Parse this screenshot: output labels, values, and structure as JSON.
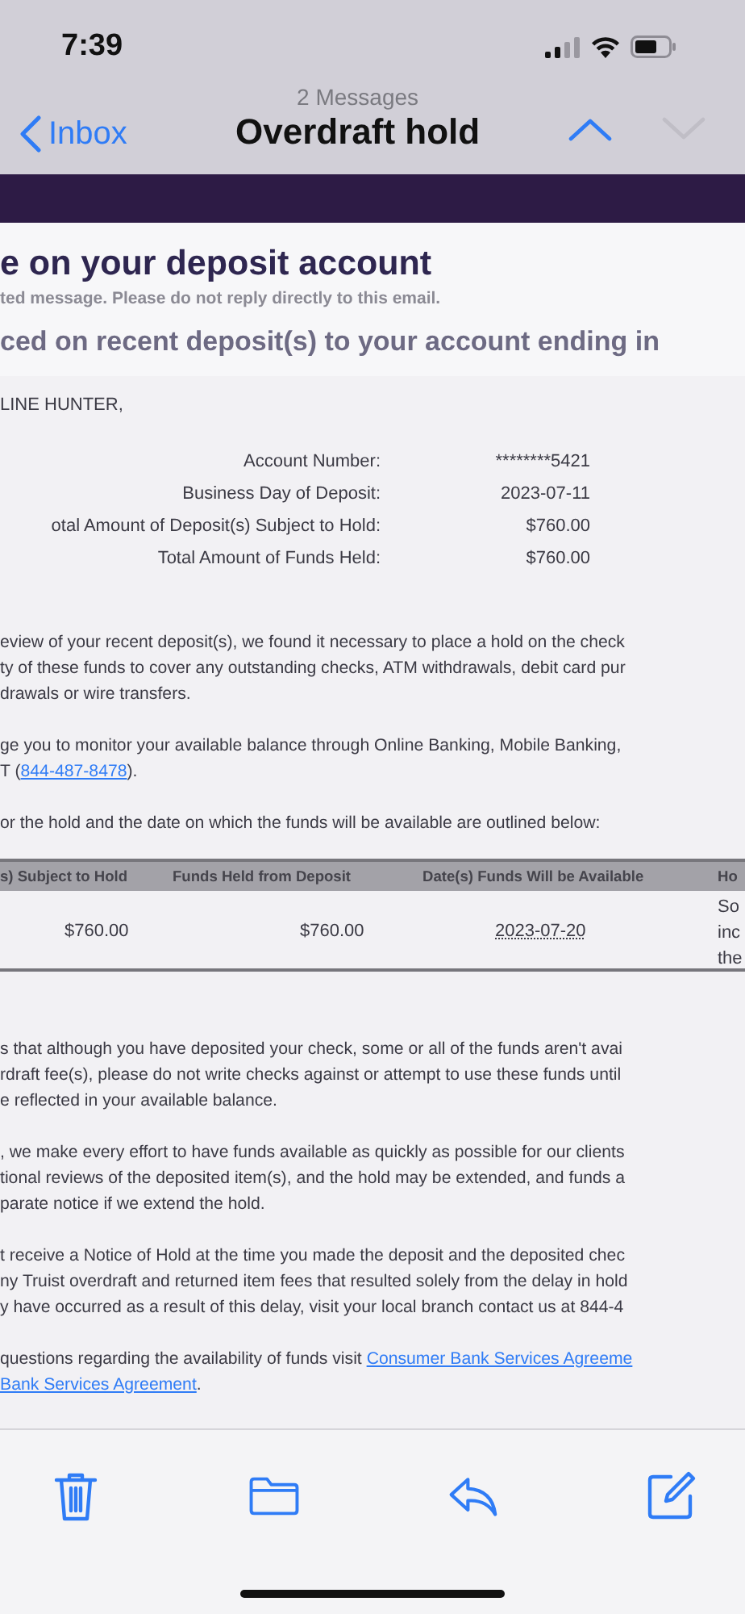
{
  "status_bar": {
    "time": "7:39"
  },
  "nav": {
    "back": "Inbox",
    "count": "2 Messages",
    "title": "Overdraft hold",
    "previous": {
      "disabled": false
    },
    "next": {
      "disabled": true
    }
  },
  "email": {
    "heading": "e on your deposit account",
    "notice": "ted message. Please do not reply directly to this email.",
    "subheading": "ced on recent deposit(s) to your account ending in",
    "greeting": "LINE HUNTER,",
    "details": [
      {
        "label": "Account Number:",
        "value": "********5421"
      },
      {
        "label": "Business Day of Deposit:",
        "value": "2023-07-11"
      },
      {
        "label": "otal Amount of Deposit(s) Subject to Hold:",
        "value": "$760.00"
      },
      {
        "label": "Total Amount of Funds Held:",
        "value": "$760.00"
      }
    ],
    "paragraphs": [
      {
        "lines": [
          [
            {
              "kind": "text",
              "text": "eview of your recent deposit(s), we found it necessary to place a hold on the check"
            }
          ],
          [
            {
              "kind": "text",
              "text": "ty of these funds to cover any outstanding checks, ATM withdrawals, debit card pur"
            }
          ],
          [
            {
              "kind": "text",
              "text": "drawals or wire transfers."
            }
          ]
        ]
      },
      {
        "lines": [
          [
            {
              "kind": "text",
              "text": "ge you to monitor your available balance through Online Banking, Mobile Banking,"
            }
          ],
          [
            {
              "kind": "text",
              "text": "T ("
            },
            {
              "kind": "link",
              "text": "844-487-8478"
            },
            {
              "kind": "text",
              "text": ")."
            }
          ]
        ]
      },
      {
        "lines": [
          [
            {
              "kind": "text",
              "text": "or the hold and the date on which the funds will be available are outlined below:"
            }
          ]
        ]
      }
    ],
    "table": {
      "columns": [
        "s) Subject to Hold",
        "Funds Held from Deposit",
        "Date(s) Funds Will be Available",
        "Ho"
      ],
      "rows": [
        {
          "cells": [
            "$760.00",
            "$760.00",
            "2023-07-20",
            "So\ninc\nthe"
          ]
        }
      ]
    },
    "paragraphs_after": [
      {
        "lines": [
          [
            {
              "kind": "text",
              "text": "s that although you have deposited your check, some or all of the funds aren't avai"
            }
          ],
          [
            {
              "kind": "text",
              "text": "rdraft fee(s), please do not write checks against or attempt to use these funds until"
            }
          ],
          [
            {
              "kind": "text",
              "text": "e reflected in your available balance."
            }
          ]
        ]
      },
      {
        "lines": [
          [
            {
              "kind": "text",
              "text": ", we make every effort to have funds available as quickly as possible for our clients"
            }
          ],
          [
            {
              "kind": "text",
              "text": "tional reviews of the deposited item(s), and the hold may be extended, and funds a"
            }
          ],
          [
            {
              "kind": "text",
              "text": "parate notice if we extend the hold."
            }
          ]
        ]
      },
      {
        "lines": [
          [
            {
              "kind": "text",
              "text": "t receive a Notice of Hold at the time you made the deposit and the deposited chec"
            }
          ],
          [
            {
              "kind": "text",
              "text": "ny Truist overdraft and returned item fees that resulted solely from the delay in hold"
            }
          ],
          [
            {
              "kind": "text",
              "text": "y have occurred as a result of this delay, visit your local branch contact us at 844-4"
            }
          ]
        ]
      },
      {
        "lines": [
          [
            {
              "kind": "text",
              "text": "questions regarding the availability of funds visit "
            },
            {
              "kind": "link",
              "text": "Consumer Bank Services Agreeme"
            }
          ],
          [
            {
              "kind": "link",
              "text": "Bank Services Agreement"
            },
            {
              "kind": "text",
              "text": "."
            }
          ]
        ]
      }
    ]
  }
}
